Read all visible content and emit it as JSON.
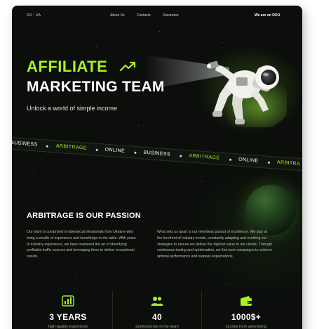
{
  "nav": {
    "lang_en": "EN",
    "lang_ua": "UA",
    "links": [
      "About Us",
      "Contacts",
      "Vacancies"
    ],
    "cta": "We are on DOU"
  },
  "hero": {
    "title_line1": "AFFILIATE",
    "title_line2": "MARKETING TEAM",
    "subtitle": "Unlock a world of simple income",
    "accent_color": "#a8f023",
    "trend_icon": "trending-up-icon",
    "illustration": "astronaut-with-flashlight"
  },
  "ribbon": {
    "items": [
      {
        "text": "BUSINESS",
        "color": "white"
      },
      {
        "text": "ARBITRAGE",
        "color": "green"
      },
      {
        "text": "ONLINE",
        "color": "white"
      },
      {
        "text": "BUSINESS",
        "color": "white"
      },
      {
        "text": "ARBITRAGE",
        "color": "green"
      },
      {
        "text": "ONLINE",
        "color": "white"
      },
      {
        "text": "ARBITRA",
        "color": "green"
      }
    ]
  },
  "passion": {
    "title": "ARBITRAGE IS OUR PASSION",
    "left_paragraph": "Our team is comprised of talented professionals from Ukraine who bring a wealth of experience and knowledge to the table. With years of industry experience, we have mastered the art of identifying profitable traffic sources and leveraging them to deliver exceptional results.",
    "right_paragraph": "What sets us apart is our relentless pursuit of excellence. We stay at the forefront of industry trends, constantly adapting and evolving our strategies to ensure we deliver the highest value to our clients. Through continuous testing and optimization, we fine-tune campaigns to achieve optimal performance and surpass expectations."
  },
  "stats": [
    {
      "icon": "bar-chart-icon",
      "value": "3 YEARS",
      "label": "high-quality experience"
    },
    {
      "icon": "people-icon",
      "value": "40",
      "label": "professionals in the team"
    },
    {
      "icon": "wallet-icon",
      "value": "1000$+",
      "label": "income from advertising"
    }
  ]
}
